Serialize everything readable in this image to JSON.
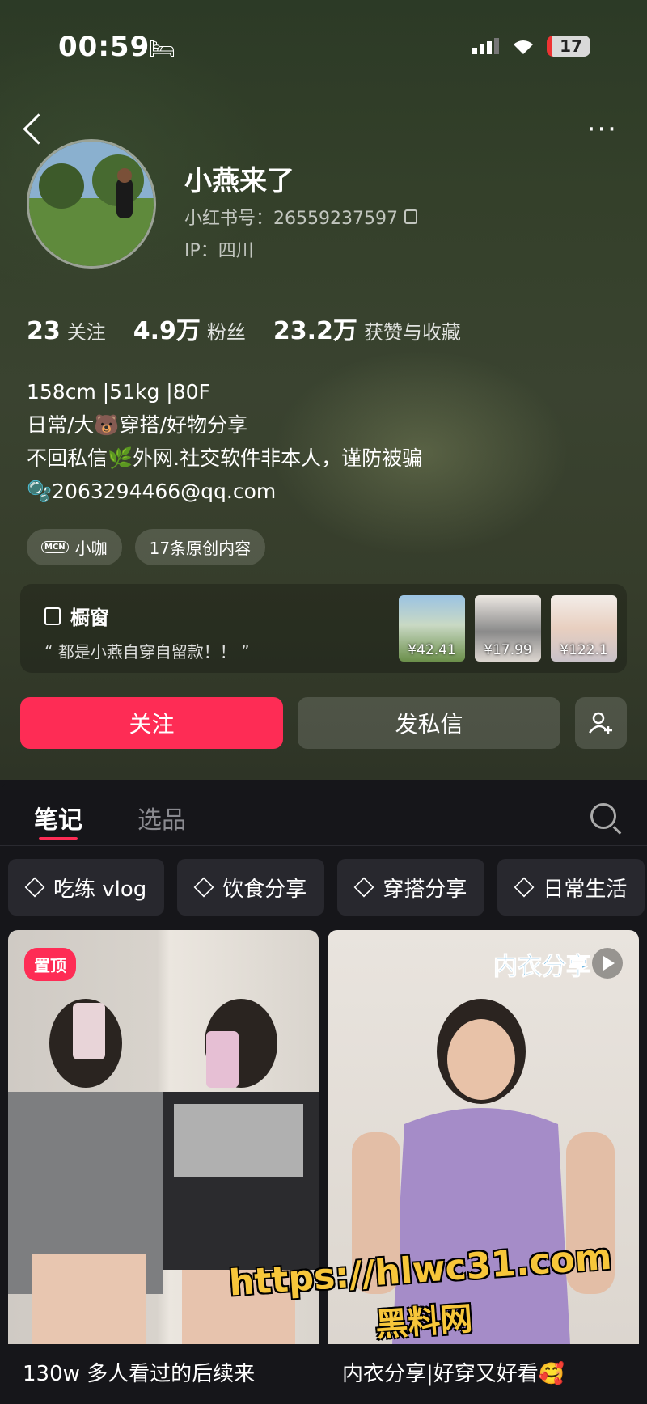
{
  "status_bar": {
    "time": "00:59",
    "battery": "17"
  },
  "profile": {
    "name": "小燕来了",
    "red_id": "小红书号：26559237597",
    "ip": "IP：四川",
    "stats": [
      {
        "num": "23",
        "label": "关注"
      },
      {
        "num": "4.9万",
        "label": "粉丝"
      },
      {
        "num": "23.2万",
        "label": "获赞与收藏"
      }
    ],
    "bio": [
      "158cm |51kg |80F",
      "日常/大🐻穿搭/好物分享",
      "不回私信🌿外网.社交软件非本人，谨防被骗",
      "🫧2063294466@qq.com"
    ],
    "tags": [
      "小咖",
      "17条原创内容"
    ],
    "mcn_badge": "MCN"
  },
  "shop": {
    "title": "橱窗",
    "subtitle": "“ 都是小燕自穿自留款！！ ”",
    "items": [
      {
        "price": "¥42.41"
      },
      {
        "price": "¥17.99"
      },
      {
        "price": "¥122.1"
      }
    ]
  },
  "actions": {
    "follow": "关注",
    "message": "发私信"
  },
  "tabs": [
    "笔记",
    "选品"
  ],
  "chips": [
    "吃练 vlog",
    "饮食分享",
    "穿搭分享",
    "日常生活"
  ],
  "notes": [
    {
      "badge": "置顶",
      "title": "130w 多人看过的后续来"
    },
    {
      "overlay": "内衣分享",
      "title": "内衣分享|好穿又好看🥰"
    }
  ],
  "watermark": {
    "line1": "https://hlwc31.com",
    "line2": "黑料网"
  },
  "colors": {
    "accent": "#fe2c55",
    "panel": "#16161a",
    "header": "#34402a"
  }
}
